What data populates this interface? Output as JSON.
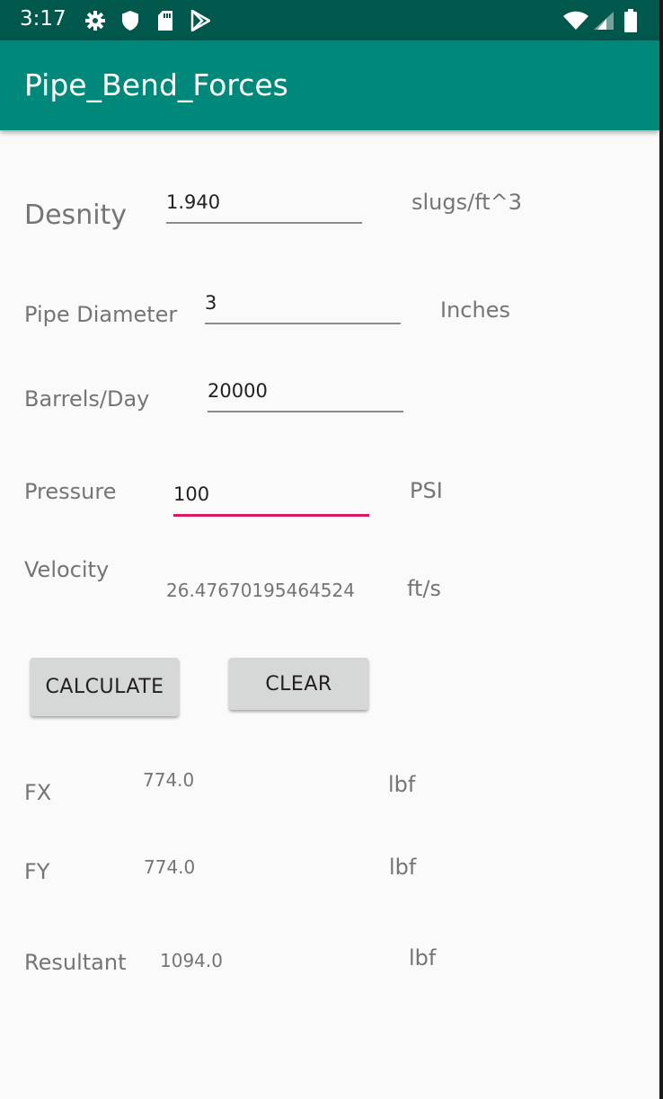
{
  "status_bar": {
    "time": "3:17",
    "left_icons": [
      "gear-icon",
      "shield-icon",
      "sd-card-icon",
      "play-store-icon"
    ],
    "right_icons": [
      "wifi-icon",
      "signal-icon",
      "battery-icon"
    ]
  },
  "app_bar": {
    "title": "Pipe_Bend_Forces"
  },
  "form": {
    "density": {
      "label": "Desnity",
      "value": "1.940",
      "unit": "slugs/ft^3"
    },
    "diameter": {
      "label": "Pipe Diameter",
      "value": "3",
      "unit": "Inches"
    },
    "barrels": {
      "label": "Barrels/Day",
      "value": "20000"
    },
    "pressure": {
      "label": "Pressure",
      "value": "100",
      "unit": "PSI"
    },
    "velocity": {
      "label": "Velocity",
      "value": "26.47670195464524",
      "unit": "ft/s"
    }
  },
  "buttons": {
    "calculate": "CALCULATE",
    "clear": "CLEAR"
  },
  "results": {
    "fx": {
      "label": "FX",
      "value": "774.0",
      "unit": "lbf"
    },
    "fy": {
      "label": "FY",
      "value": "774.0",
      "unit": "lbf"
    },
    "resultant": {
      "label": "Resultant",
      "value": "1094.0",
      "unit": "lbf"
    }
  },
  "colors": {
    "status_bar": "#00574c",
    "app_bar": "#00897b",
    "accent": "#d81b60",
    "background": "#fafafa",
    "button": "#d6d7d7"
  }
}
